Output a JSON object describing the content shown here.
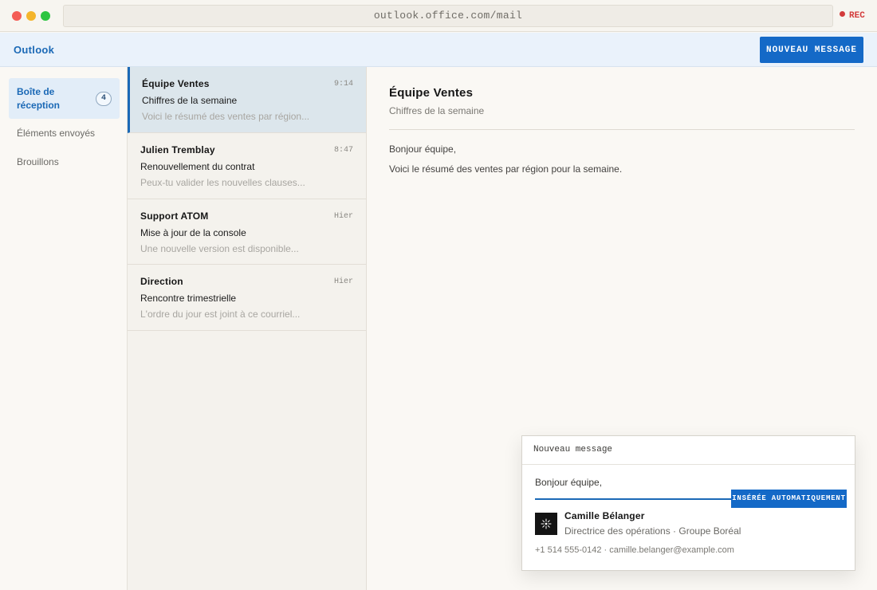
{
  "browser": {
    "url": "outlook.office.com/mail",
    "rec_label": "REC",
    "colors": {
      "close": "#f45c55",
      "minimize": "#f4b52c",
      "maximize": "#2cc541",
      "rec": "#d33b3b"
    }
  },
  "app": {
    "name": "Outlook",
    "new_message_label": "NOUVEAU MESSAGE",
    "accent_color": "#1469c7"
  },
  "sidebar": {
    "items": [
      {
        "label": "Boîte de réception",
        "badge": "4",
        "active": true
      },
      {
        "label": "Éléments envoyés",
        "active": false
      },
      {
        "label": "Brouillons",
        "active": false
      }
    ]
  },
  "mail_list": {
    "items": [
      {
        "sender": "Équipe Ventes",
        "time": "9:14",
        "subject": "Chiffres de la semaine",
        "preview": "Voici le résumé des ventes par région...",
        "selected": true
      },
      {
        "sender": "Julien Tremblay",
        "time": "8:47",
        "subject": "Renouvellement du contrat",
        "preview": "Peux-tu valider les nouvelles clauses...",
        "selected": false
      },
      {
        "sender": "Support ATOM",
        "time": "Hier",
        "subject": "Mise à jour de la console",
        "preview": "Une nouvelle version est disponible...",
        "selected": false
      },
      {
        "sender": "Direction",
        "time": "Hier",
        "subject": "Rencontre trimestrielle",
        "preview": "L'ordre du jour est joint à ce courriel...",
        "selected": false
      }
    ]
  },
  "reading_pane": {
    "sender": "Équipe Ventes",
    "subject": "Chiffres de la semaine",
    "greeting": "Bonjour équipe,",
    "body": "Voici le résumé des ventes par région pour la semaine."
  },
  "compose": {
    "title": "Nouveau message",
    "greeting": "Bonjour équipe,",
    "auto_inserted_label": "INSÉRÉE AUTOMATIQUEMENT",
    "signature": {
      "name": "Camille Bélanger",
      "title": "Directrice des opérations · Groupe Boréal",
      "contact": "+1 514 555-0142 · camille.belanger@example.com"
    }
  }
}
